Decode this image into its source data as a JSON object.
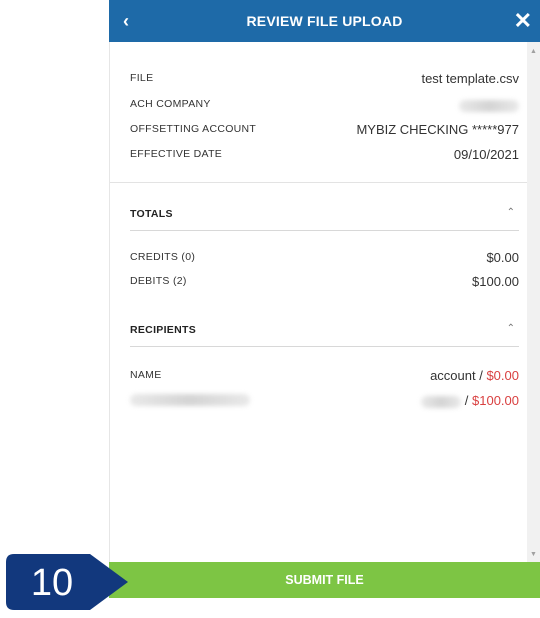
{
  "header": {
    "title": "REVIEW FILE UPLOAD",
    "back_icon": "‹",
    "close_icon": "✕"
  },
  "details": {
    "file_label": "FILE",
    "file_value": "test template.csv",
    "ach_label": "ACH COMPANY",
    "offset_label": "OFFSETTING ACCOUNT",
    "offset_value": "MYBIZ CHECKING *****977",
    "date_label": "EFFECTIVE DATE",
    "date_value": "09/10/2021"
  },
  "totals": {
    "title": "TOTALS",
    "credits_label": "CREDITS (0)",
    "credits_value": "$0.00",
    "debits_label": "DEBITS (2)",
    "debits_value": "$100.00"
  },
  "recipients": {
    "title": "RECIPIENTS",
    "name_label": "NAME",
    "header_account": "account /",
    "header_amount": "$0.00",
    "row_amount": "$100.00"
  },
  "submit_label": "SUBMIT FILE",
  "step_badge": "10",
  "colors": {
    "header": "#1e6aa8",
    "submit": "#7dc544",
    "badge": "#12387d",
    "amount_red": "#d94040"
  }
}
